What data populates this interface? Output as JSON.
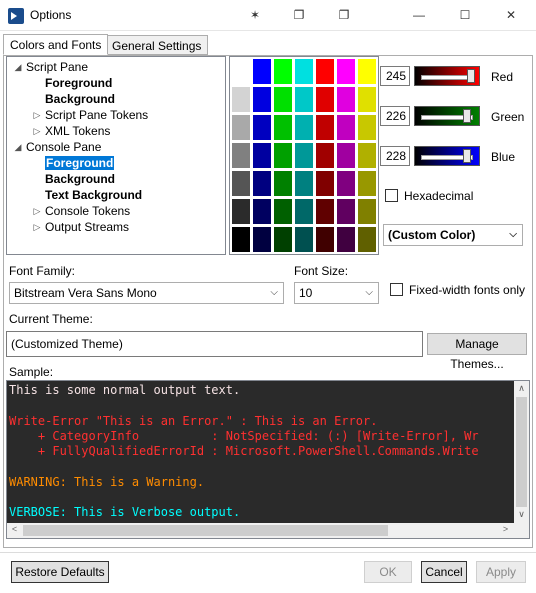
{
  "window": {
    "title": "Options",
    "pin_glyph": "✶",
    "restore_glyph": "❐",
    "min_glyph": "—",
    "max_glyph": "☐",
    "close_glyph": "✕"
  },
  "tabs": [
    {
      "label": "Colors and Fonts"
    },
    {
      "label": "General Settings"
    }
  ],
  "tree": {
    "items": [
      {
        "label": "Script Pane",
        "caret": "◢",
        "bold": false,
        "selected": false
      },
      {
        "label": "Foreground",
        "caret": "",
        "bold": true,
        "selected": false
      },
      {
        "label": "Background",
        "caret": "",
        "bold": true,
        "selected": false
      },
      {
        "label": "Script Pane Tokens",
        "caret": "▷",
        "bold": false,
        "selected": false
      },
      {
        "label": "XML Tokens",
        "caret": "▷",
        "bold": false,
        "selected": false
      },
      {
        "label": "Console Pane",
        "caret": "◢",
        "bold": false,
        "selected": false
      },
      {
        "label": "Foreground",
        "caret": "",
        "bold": true,
        "selected": true
      },
      {
        "label": "Background",
        "caret": "",
        "bold": true,
        "selected": false
      },
      {
        "label": "Text Background",
        "caret": "",
        "bold": true,
        "selected": false
      },
      {
        "label": "Console Tokens",
        "caret": "▷",
        "bold": false,
        "selected": false
      },
      {
        "label": "Output Streams",
        "caret": "▷",
        "bold": false,
        "selected": false
      }
    ]
  },
  "palette": {
    "columns": [
      [
        "#ffffff",
        "#d3d3d3",
        "#a9a9a9",
        "#808080",
        "#555555",
        "#2b2b2b",
        "#000000"
      ],
      [
        "#0000ff",
        "#0000e0",
        "#0000c0",
        "#0000a0",
        "#000080",
        "#000060",
        "#000040"
      ],
      [
        "#00ff00",
        "#00e000",
        "#00c000",
        "#00a000",
        "#008000",
        "#006000",
        "#004000"
      ],
      [
        "#00e0e0",
        "#00c8c8",
        "#00b0b0",
        "#009898",
        "#008080",
        "#006868",
        "#005050"
      ],
      [
        "#ff0000",
        "#e00000",
        "#c00000",
        "#a00000",
        "#800000",
        "#600000",
        "#400000"
      ],
      [
        "#ff00ff",
        "#e000e0",
        "#c000c0",
        "#a000a0",
        "#800080",
        "#600060",
        "#400040"
      ],
      [
        "#ffff00",
        "#e0e000",
        "#c8c800",
        "#b0b000",
        "#989800",
        "#808000",
        "#606000"
      ]
    ]
  },
  "color": {
    "red": {
      "value": "245",
      "label": "Red",
      "fraction": 0.96,
      "track": "#ff0000"
    },
    "green": {
      "value": "226",
      "label": "Green",
      "fraction": 0.89,
      "track": "#008000"
    },
    "blue": {
      "value": "228",
      "label": "Blue",
      "fraction": 0.89,
      "track": "#0000ff"
    },
    "hexadecimal_label": "Hexadecimal",
    "hexadecimal_checked": false,
    "preset_combo": "(Custom Color)"
  },
  "font": {
    "family_label": "Font Family:",
    "family_value": "Bitstream Vera Sans Mono",
    "size_label": "Font Size:",
    "size_value": "10",
    "fixed_width_label": "Fixed-width fonts only",
    "fixed_width_checked": false
  },
  "theme": {
    "label": "Current Theme:",
    "value": "(Customized Theme)",
    "manage_button": "Manage Themes..."
  },
  "sample": {
    "label": "Sample:",
    "background": "#2a2a2a",
    "lines": [
      {
        "parts": [
          {
            "text": "This is some normal output text.",
            "color": "#f5e2e4"
          }
        ]
      },
      {
        "parts": [
          {
            "text": "",
            "color": "#f5e2e4"
          }
        ]
      },
      {
        "parts": [
          {
            "text": "Write-Error \"This is an Error.\" : This is an Error.",
            "color": "#ff3030"
          }
        ]
      },
      {
        "parts": [
          {
            "text": "    + CategoryInfo          : NotSpecified: (:) [Write-Error], Wr",
            "color": "#ff3030"
          }
        ]
      },
      {
        "parts": [
          {
            "text": "    + FullyQualifiedErrorId : Microsoft.PowerShell.Commands.Write",
            "color": "#ff3030"
          }
        ]
      },
      {
        "parts": [
          {
            "text": "",
            "color": "#f5e2e4"
          }
        ]
      },
      {
        "parts": [
          {
            "text": "WARNING: This is a Warning.",
            "color": "#ff8c00"
          }
        ]
      },
      {
        "parts": [
          {
            "text": "",
            "color": "#f5e2e4"
          }
        ]
      },
      {
        "parts": [
          {
            "text": "VERBOSE: This is Verbose output.",
            "color": "#00ffff"
          }
        ]
      }
    ]
  },
  "buttons": {
    "restore_defaults": "Restore Defaults",
    "ok": "OK",
    "cancel": "Cancel",
    "apply": "Apply"
  }
}
